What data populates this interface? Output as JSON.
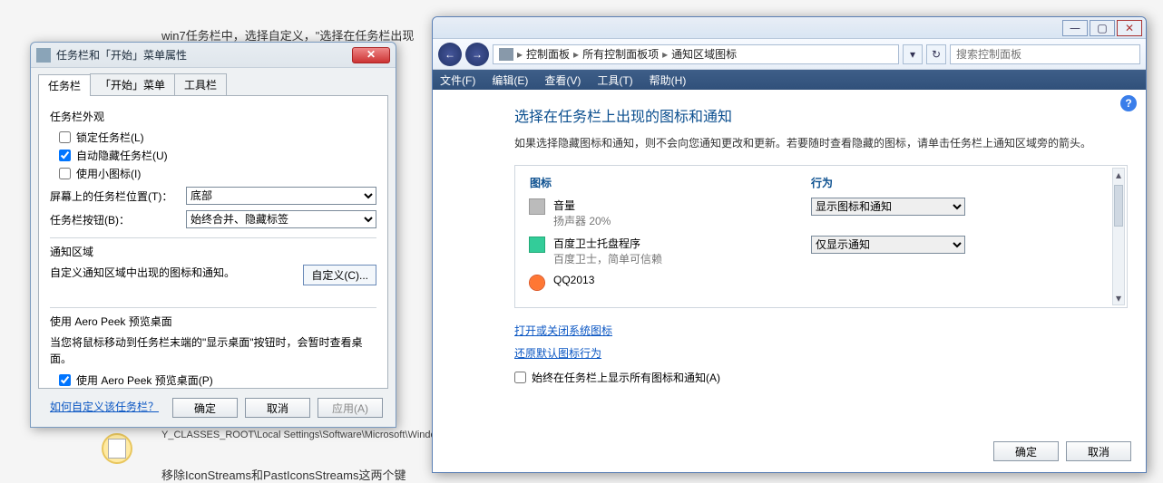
{
  "background": {
    "line1": "win7任务栏中，选择自定义，\"选择在任务栏出现",
    "line2": "Y_CLASSES_ROOT\\Local Settings\\Software\\Microsoft\\Windows",
    "line3": "移除IconStreams和PastIconsStreams这两个键"
  },
  "taskbar_dialog": {
    "title": "任务栏和「开始」菜单属性",
    "tabs": {
      "taskbar": "任务栏",
      "start": "「开始」菜单",
      "toolbars": "工具栏"
    },
    "group_appearance": "任务栏外观",
    "chk_lock": "锁定任务栏(L)",
    "chk_autohide": "自动隐藏任务栏(U)",
    "chk_smallicons": "使用小图标(I)",
    "row_position_label": "屏幕上的任务栏位置(T)：",
    "row_position_value": "底部",
    "row_buttons_label": "任务栏按钮(B)：",
    "row_buttons_value": "始终合并、隐藏标签",
    "group_notif": "通知区域",
    "notif_desc": "自定义通知区域中出现的图标和通知。",
    "customize_btn": "自定义(C)...",
    "group_peek": "使用 Aero Peek 预览桌面",
    "peek_desc": "当您将鼠标移动到任务栏末端的\"显示桌面\"按钮时，会暂时查看桌面。",
    "chk_peek": "使用 Aero Peek 预览桌面(P)",
    "help_link": "如何自定义该任务栏？",
    "btn_ok": "确定",
    "btn_cancel": "取消",
    "btn_apply": "应用(A)"
  },
  "cp_window": {
    "win_min": "—",
    "win_max": "▢",
    "win_close": "✕",
    "nav_back": "←",
    "nav_fwd": "→",
    "breadcrumb": {
      "seg1": "控制面板",
      "seg2": "所有控制面板项",
      "seg3": "通知区域图标",
      "chev": "▸"
    },
    "refresh": "↻",
    "search_placeholder": "搜索控制面板",
    "menus": {
      "file": "文件(F)",
      "edit": "编辑(E)",
      "view": "查看(V)",
      "tools": "工具(T)",
      "help": "帮助(H)"
    },
    "help_icon": "?",
    "title": "选择在任务栏上出现的图标和通知",
    "desc": "如果选择隐藏图标和通知，则不会向您通知更改和更新。若要随时查看隐藏的图标，请单击任务栏上通知区域旁的箭头。",
    "col_icon": "图标",
    "col_behavior": "行为",
    "items": [
      {
        "name": "音量",
        "sub": "扬声器 20%",
        "behavior": "显示图标和通知",
        "icon": "ico-speaker"
      },
      {
        "name": "百度卫士托盘程序",
        "sub": "百度卫士，简单可信赖",
        "behavior": "仅显示通知",
        "icon": "ico-shield"
      },
      {
        "name": "QQ2013",
        "sub": "",
        "behavior": "",
        "icon": "ico-qq"
      }
    ],
    "link_sysicons": "打开或关闭系统图标",
    "link_restore": "还原默认图标行为",
    "chk_always": "始终在任务栏上显示所有图标和通知(A)",
    "btn_ok": "确定",
    "btn_cancel": "取消"
  }
}
